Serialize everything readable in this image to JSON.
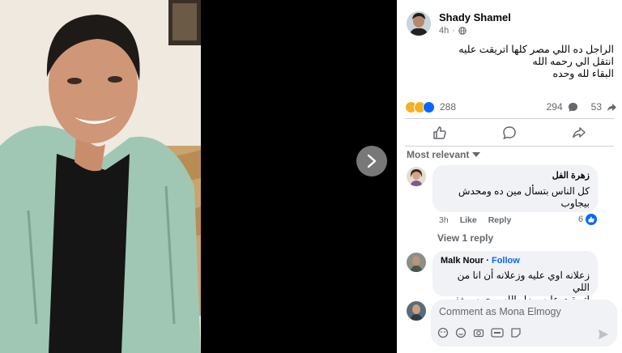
{
  "post": {
    "author": "Shady Shamel",
    "time": "4h",
    "text_line1": "الراجل ده اللي مصر كلها اتريقت عليه",
    "text_line2": "انتقل الي رحمه الله",
    "text_line3": "البقاء لله وحده",
    "reactions_count": "288",
    "comments_count": "294",
    "shares_count": "53"
  },
  "sort_label": "Most relevant",
  "comments": [
    {
      "name": "زهرة الفل",
      "text_line1": "كل الناس بتسأل مين ده ومحدش",
      "text_line2": "بيجاوب",
      "time": "3h",
      "like_label": "Like",
      "reply_label": "Reply",
      "likes": "6"
    },
    {
      "name": "Malk Nour",
      "follow_label": "Follow",
      "text_line1": "زعلانه اوي عليه وزعلانه أن انا من اللي",
      "text_line2": "اتريقت عليه بهزار الله يرحمه ويغفر له"
    }
  ],
  "view_replies": "View 1 reply",
  "composer": {
    "placeholder": "Comment as Mona Elmogy"
  },
  "colors": {
    "accent": "#0866ff",
    "secondary_text": "#65676b",
    "bubble": "#f0f2f5"
  }
}
